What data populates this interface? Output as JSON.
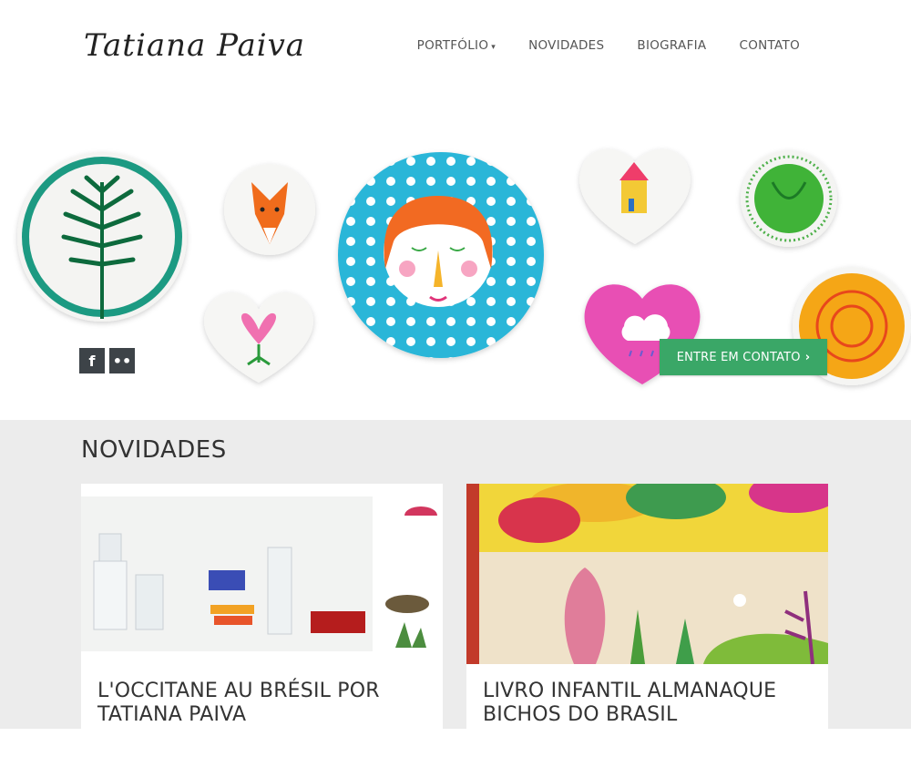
{
  "brand": {
    "logo_text": "Tatiana Paiva"
  },
  "nav": {
    "items": [
      {
        "label": "PORTFÓLIO"
      },
      {
        "label": "NOVIDADES"
      },
      {
        "label": "BIOGRAFIA"
      },
      {
        "label": "CONTATO"
      }
    ],
    "dropdown_icon": "caret-down-icon"
  },
  "hero": {
    "cta_label": "ENTRE EM CONTATO",
    "cta_icon": "chevron-right-icon",
    "social": [
      {
        "icon": "facebook-icon",
        "glyph": "f"
      },
      {
        "icon": "flickr-icon",
        "glyph": "••"
      }
    ],
    "colors": {
      "cta": "#3aa767",
      "social": "#3d4348"
    }
  },
  "news": {
    "heading": "NOVIDADES",
    "cards": [
      {
        "title": "L'OCCITANE AU BRÉSIL POR TATIANA PAIVA"
      },
      {
        "title": "LIVRO INFANTIL ALMANAQUE BICHOS DO BRASIL"
      }
    ]
  }
}
